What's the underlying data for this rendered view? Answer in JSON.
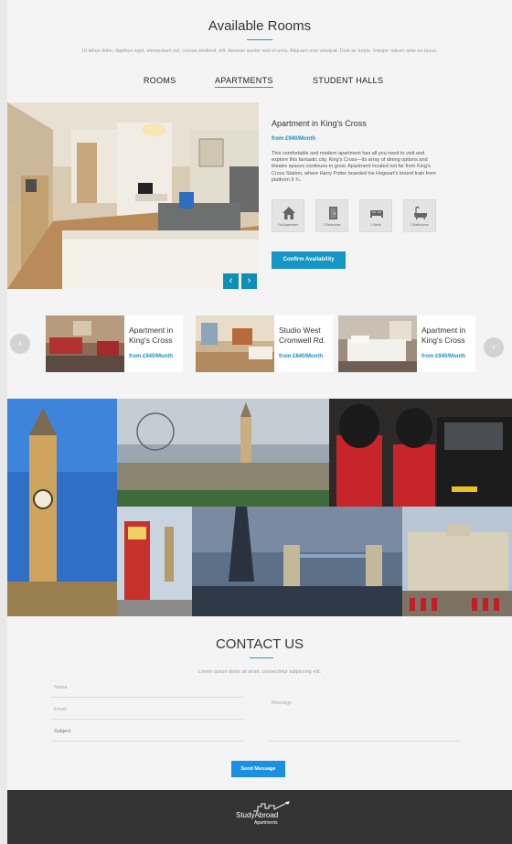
{
  "rooms": {
    "title": "Available Rooms",
    "intro": "Ut tellus dolor, dapibus eget, elementum vel, cursus eleifend, elit. Aenean auctor wisi et urna. Aliquam erat volutpat. Duis ac turpis. Integer rutrum ante eu lacus.",
    "tabs": [
      "ROOMS",
      "APARTMENTS",
      "STUDENT HALLS"
    ],
    "active_tab": "APARTMENTS"
  },
  "featured": {
    "title": "Apartment in King's Cross",
    "price": "from £940/Month",
    "description": "This comfortable and modern apartment has all you need to visit and explore this fantastic city. King's Cross—its array of dining options and theatre spaces continues to grow. Apartment located not far from King's Cross Station, where Harry Potter boarded his Hogwart's bound train from platform 9 ¾.",
    "features": [
      {
        "icon": "home-icon",
        "label": "Full Apartment"
      },
      {
        "icon": "door-icon",
        "label": "2 Bedrooms"
      },
      {
        "icon": "bed-icon",
        "label": "2 Beds"
      },
      {
        "icon": "bathtub-icon",
        "label": "2 Bathrooms"
      }
    ],
    "confirm_label": "Confirm Availability",
    "prev_label": "‹",
    "next_label": "›"
  },
  "carousel": {
    "prev_label": "‹",
    "next_label": "›",
    "cards": [
      {
        "title": "Apartment in King's Cross",
        "price": "from £940/Month"
      },
      {
        "title": "Studio West Cromwell Rd.",
        "price": "from £840/Month"
      },
      {
        "title": "Apartment in King's Cross",
        "price": "from £940/Month"
      }
    ]
  },
  "contact": {
    "title": "CONTACT US",
    "subtitle": "Lorem ipsum dolor sit amet, consectetur adipiscing elit.",
    "name_placeholder": "Name",
    "email_placeholder": "Email",
    "subject_placeholder": "Subject",
    "message_placeholder": "Message",
    "send_label": "Send Message"
  },
  "footer": {
    "logo_text": "StudyAbroad",
    "logo_sub": "Apartments"
  },
  "colors": {
    "accent": "#1596c4",
    "footer_bg": "#333333"
  }
}
